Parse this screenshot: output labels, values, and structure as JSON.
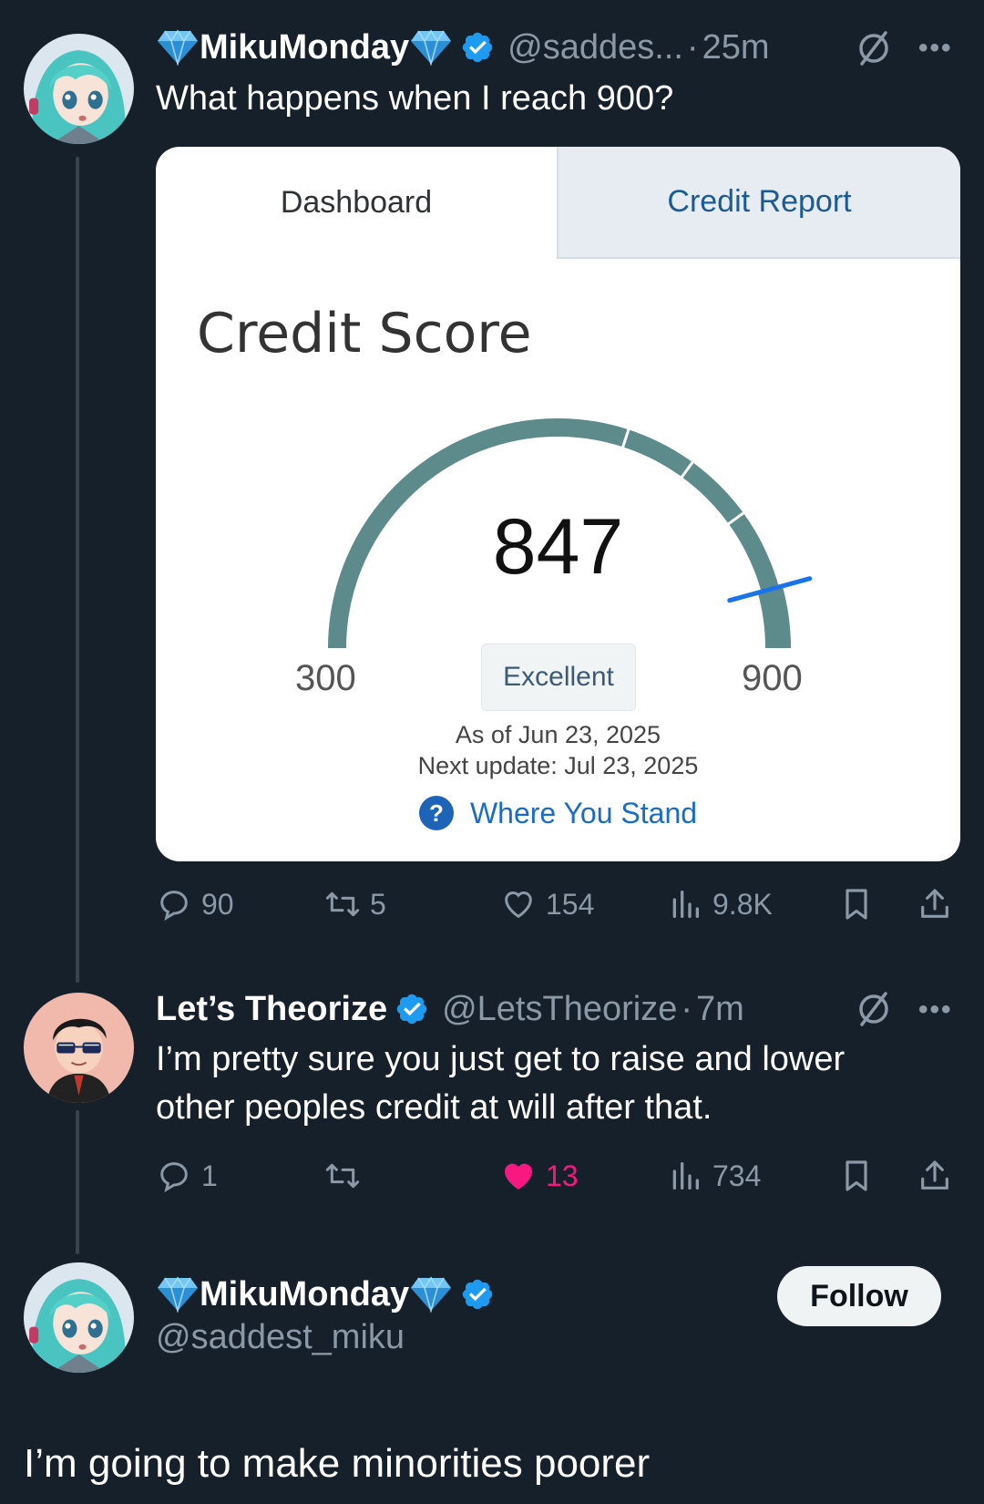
{
  "tweet1": {
    "name": "MikuMonday",
    "handle": "@saddes...",
    "time": "25m",
    "text": "What happens when I reach 900?",
    "more": "•••",
    "card": {
      "tab_dashboard": "Dashboard",
      "tab_report": "Credit Report",
      "title": "Credit Score",
      "score": "847",
      "min_label": "300",
      "max_label": "900",
      "rating": "Excellent",
      "as_of": "As of Jun 23, 2025",
      "next_update": "Next update: Jul 23, 2025",
      "where_link": "Where You Stand",
      "gauge_min": 300,
      "gauge_max": 900,
      "gauge_value": 847,
      "gauge_color": "#5d8a8a",
      "marker_color": "#1a73e8"
    },
    "actions": {
      "replies": "90",
      "retweets": "5",
      "likes": "154",
      "views": "9.8K"
    }
  },
  "tweet2": {
    "name": "Let’s Theorize",
    "handle": "@LetsTheorize",
    "time": "7m",
    "more": "•••",
    "text_line1": "I’m pretty sure you just get to raise and lower",
    "text_line2": "other peoples credit at will after that.",
    "actions": {
      "replies": "1",
      "retweets": "",
      "likes": "13",
      "views": "734"
    }
  },
  "tweet3": {
    "name": "MikuMonday",
    "handle": "@saddest_miku",
    "follow_label": "Follow",
    "text": "I’m going to make minorities poorer"
  },
  "colors": {
    "background": "#15202b",
    "secondary_text": "#8b98a5",
    "verified": "#1d9bf0",
    "like": "#f91880"
  }
}
